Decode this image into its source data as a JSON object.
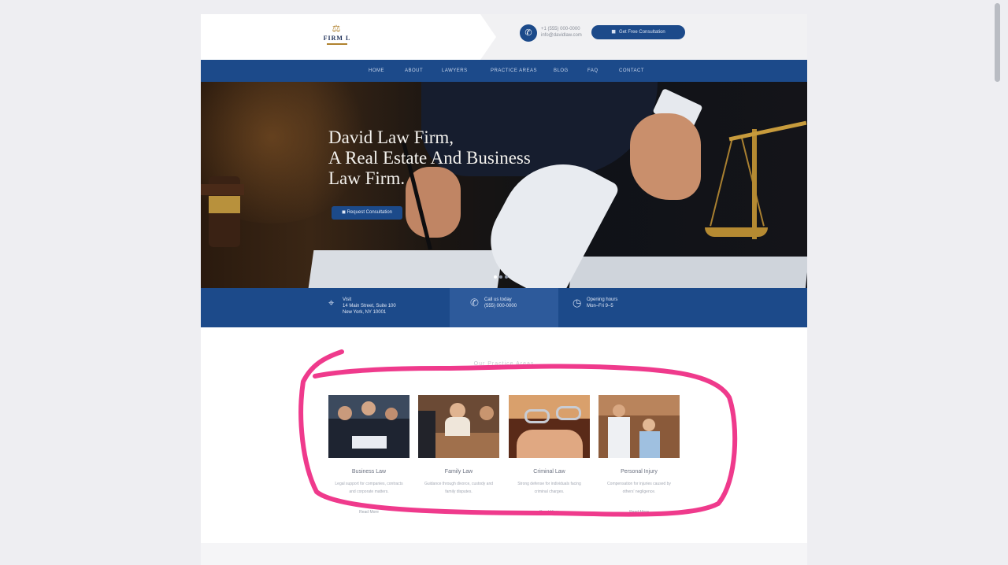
{
  "header": {
    "logo_mark": "⚖",
    "logo_text": "FIRM L",
    "phone_lines": [
      "+1 (555) 000-0000",
      "info@davidlaw.com"
    ],
    "phone_icon": "phone-icon",
    "cta_label": "Get Free Consultation",
    "cta_icon": "chat-icon"
  },
  "nav": {
    "items": [
      "HOME",
      "ABOUT",
      "LAWYERS",
      "PRACTICE AREAS",
      "BLOG",
      "FAQ",
      "CONTACT"
    ]
  },
  "hero": {
    "title_lines": [
      "David Law Firm,",
      "A Real Estate And Business",
      "Law Firm."
    ],
    "button_label": "Request Consultation",
    "button_icon": "chat-icon",
    "slides_total": 3,
    "slide_active": 1
  },
  "features": [
    {
      "icon": "map-pin-icon",
      "lines": [
        "Visit",
        "14 Main Street, Suite 100",
        "New York, NY 10001"
      ]
    },
    {
      "icon": "phone-icon",
      "lines": [
        "Call us today",
        "(555) 000-0000"
      ]
    },
    {
      "icon": "clock-icon",
      "lines": [
        "Opening hours",
        "Mon–Fri 9–5"
      ]
    }
  ],
  "practice": {
    "section_title": "Our Practice Areas",
    "cards": [
      {
        "title": "Business Law",
        "desc": "Legal support for companies, contracts and corporate matters.",
        "link": "Read More"
      },
      {
        "title": "Family Law",
        "desc": "Guidance through divorce, custody and family disputes.",
        "link": "Read More"
      },
      {
        "title": "Criminal Law",
        "desc": "Strong defense for individuals facing criminal charges.",
        "link": "Read More"
      },
      {
        "title": "Personal Injury",
        "desc": "Compensation for injuries caused by others' negligence.",
        "link": "Read More"
      }
    ]
  },
  "annotation": {
    "color": "#ef3a8c"
  },
  "colors": {
    "brand_blue": "#1c4a8a",
    "gold": "#b0822e"
  }
}
